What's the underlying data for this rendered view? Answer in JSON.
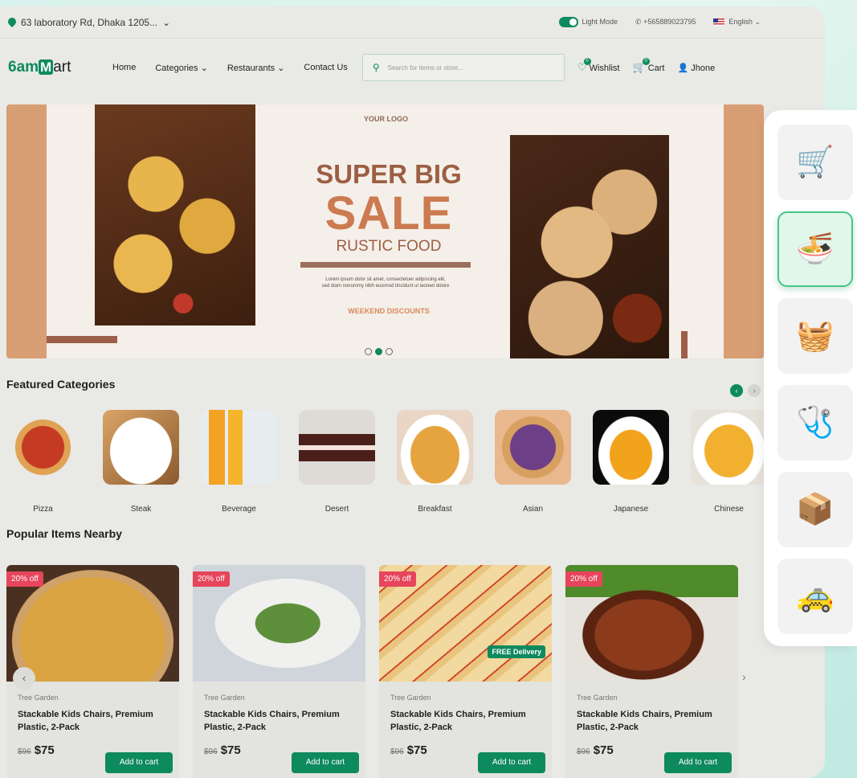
{
  "topbar": {
    "address": "63 laboratory Rd, Dhaka 1205...",
    "mode_label": "Light Mode",
    "phone": "+565889023795",
    "language": "English"
  },
  "nav": {
    "logo_prefix": "6am",
    "logo_mid": "M",
    "logo_suffix": "art",
    "links": [
      "Home",
      "Categories",
      "Restaurants",
      "Contact Us"
    ],
    "search_placeholder": "Search for items or store...",
    "wishlist_label": "Wishlist",
    "wishlist_count": "0",
    "cart_label": "Cart",
    "cart_count": "0",
    "user_name": "Jhone"
  },
  "banner": {
    "logo_text": "YOUR LOGO",
    "line1": "SUPER BIG",
    "line2": "SALE",
    "line3": "RUSTIC FOOD",
    "body": "Lorem ipsum dolor sit amet, consectetuer adipiscing elit, sed diam nonummy nibh euismod tincidunt ut laoreet dolore",
    "promo": "WEEKEND DISCOUNTS"
  },
  "featured": {
    "title": "Featured Categories",
    "categories": [
      "Pizza",
      "Steak",
      "Beverage",
      "Desert",
      "Breakfast",
      "Asian",
      "Japanese",
      "Chinese"
    ]
  },
  "popular": {
    "title": "Popular Items Nearby",
    "items": [
      {
        "discount": "20% off",
        "shop": "Tree Garden",
        "name": "Stackable Kids Chairs, Premium Plastic, 2-Pack",
        "old_price": "$96",
        "price": "$75",
        "button": "Add to cart",
        "free": ""
      },
      {
        "discount": "20% off",
        "shop": "Tree Garden",
        "name": "Stackable Kids Chairs, Premium Plastic, 2-Pack",
        "old_price": "$96",
        "price": "$75",
        "button": "Add to cart",
        "free": ""
      },
      {
        "discount": "20% off",
        "shop": "Tree Garden",
        "name": "Stackable Kids Chairs, Premium Plastic, 2-Pack",
        "old_price": "$96",
        "price": "$75",
        "button": "Add to cart",
        "free": "FREE Delivery"
      },
      {
        "discount": "20% off",
        "shop": "Tree Garden",
        "name": "Stackable Kids Chairs, Premium Plastic, 2-Pack",
        "old_price": "$96",
        "price": "$75",
        "button": "Add to cart",
        "free": ""
      }
    ]
  },
  "side_modules": [
    "shop-cart-icon",
    "noodle-bowl-icon",
    "grocery-basket-icon",
    "first-aid-kit-icon",
    "parcel-icon",
    "taxi-icon"
  ],
  "colors": {
    "brand": "#0e8a5f",
    "discount": "#e6455b",
    "accent": "#cc7a4f"
  }
}
